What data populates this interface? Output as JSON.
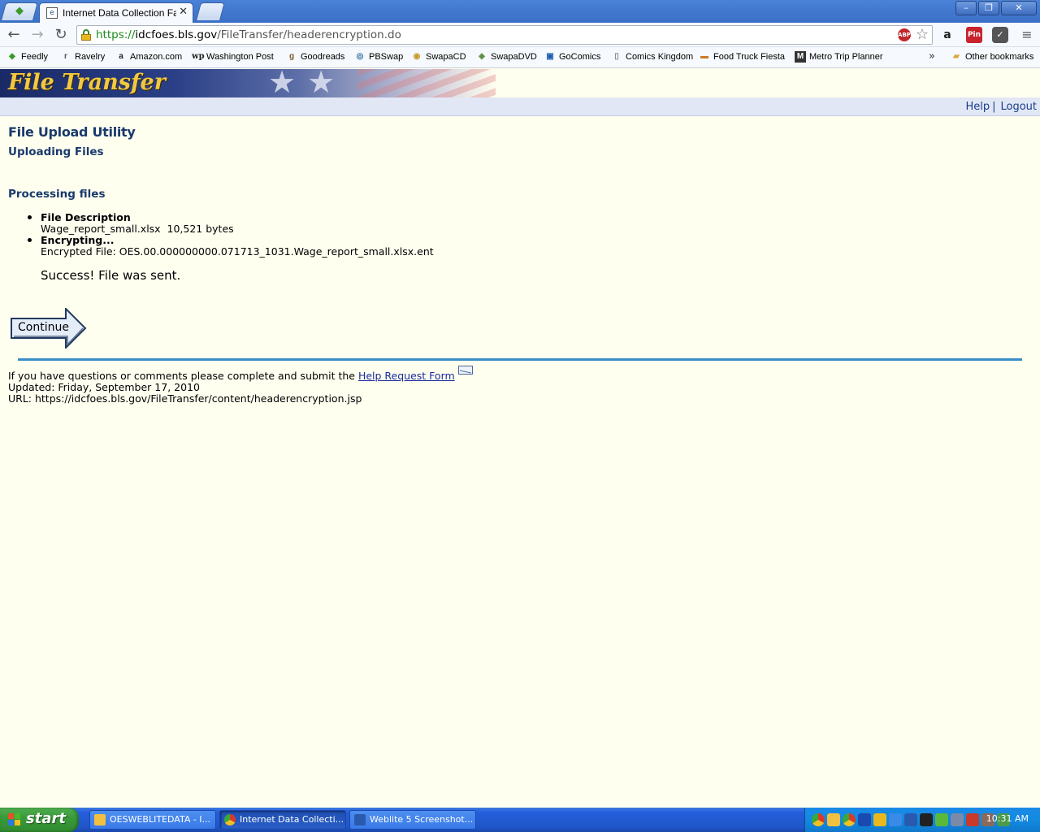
{
  "browser": {
    "tab_title": "Internet Data Collection Faci",
    "url_scheme": "https://",
    "url_host": "idcfoes.bls.gov",
    "url_path": "/FileTransfer/headerencryption.do",
    "bookmarks": [
      {
        "label": "Feedly",
        "icon": "feedly-icon"
      },
      {
        "label": "Ravelry",
        "icon": "ravelry-icon"
      },
      {
        "label": "Amazon.com",
        "icon": "amazon-icon"
      },
      {
        "label": "Washington Post",
        "icon": "wapo-icon"
      },
      {
        "label": "Goodreads",
        "icon": "goodreads-icon"
      },
      {
        "label": "PBSwap",
        "icon": "pbswap-icon"
      },
      {
        "label": "SwapaCD",
        "icon": "swapacd-icon"
      },
      {
        "label": "SwapaDVD",
        "icon": "swapadvd-icon"
      },
      {
        "label": "GoComics",
        "icon": "gocomics-icon"
      },
      {
        "label": "Comics Kingdom",
        "icon": "page-icon"
      },
      {
        "label": "Food Truck Fiesta",
        "icon": "foodtruck-icon"
      },
      {
        "label": "Metro Trip Planner",
        "icon": "metro-icon"
      }
    ],
    "other_bookmarks": "Other bookmarks",
    "overflow": "»"
  },
  "site": {
    "banner_title": "File Transfer",
    "nav": {
      "help": "Help",
      "separator": "|",
      "logout": "Logout"
    }
  },
  "page": {
    "title": "File Upload Utility",
    "subtitle": "Uploading Files",
    "section": "Processing files",
    "items": [
      {
        "label": "File Description",
        "detail": "Wage_report_small.xlsx  10,521 bytes"
      },
      {
        "label": "Encrypting...",
        "detail": "Encrypted File: OES.00.000000000.071713_1031.Wage_report_small.xlsx.ent"
      }
    ],
    "success": "Success! File was sent.",
    "continue": "Continue"
  },
  "footer": {
    "question_text": "If you have questions or comments please complete and submit the",
    "help_link": "Help Request Form",
    "updated": "Updated: Friday, September 17, 2010",
    "url_line": "URL: https://idcfoes.bls.gov/FileTransfer/content/headerencryption.jsp"
  },
  "taskbar": {
    "start": "start",
    "tasks": [
      {
        "label": "OESWEBLITEDATA - I...",
        "active": false
      },
      {
        "label": "Internet Data Collecti...",
        "active": true
      },
      {
        "label": "Weblite 5 Screenshot...",
        "active": false
      }
    ],
    "clock": "10:31 AM"
  }
}
